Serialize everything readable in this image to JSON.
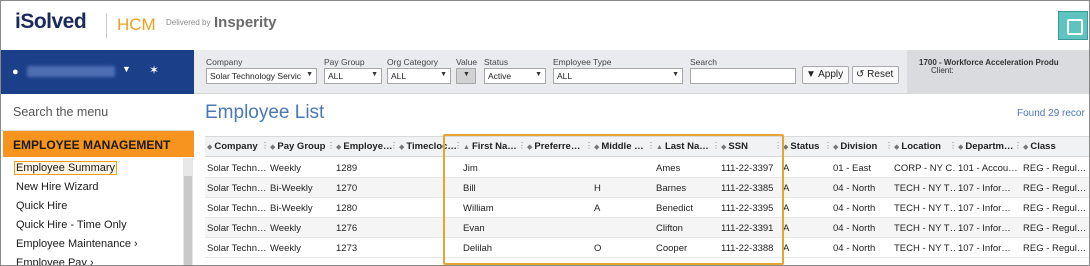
{
  "header": {
    "logo": "iSolved",
    "product": "HCM",
    "delivered_by": "Delivered by",
    "partner": "Insperity",
    "corner_icon": "app-icon"
  },
  "sidebar": {
    "user_icon": "user-icon",
    "pin_icon": "pin-icon",
    "search_placeholder": "Search the menu",
    "section": "EMPLOYEE MANAGEMENT",
    "items": [
      {
        "label": "Employee Summary",
        "selected": true
      },
      {
        "label": "New Hire Wizard"
      },
      {
        "label": "Quick Hire"
      },
      {
        "label": "Quick Hire - Time Only"
      },
      {
        "label": "Employee Maintenance ›"
      },
      {
        "label": "Employee Pay ›"
      }
    ]
  },
  "filters": {
    "company": {
      "label": "Company",
      "value": "Solar Technology Servic"
    },
    "pay_group": {
      "label": "Pay Group",
      "value": "ALL"
    },
    "org_category": {
      "label": "Org Category",
      "value": "ALL"
    },
    "value": {
      "label": "Value"
    },
    "status": {
      "label": "Status",
      "value": "Active"
    },
    "employee_type": {
      "label": "Employee Type",
      "value": "ALL"
    },
    "search": {
      "label": "Search",
      "value": ""
    },
    "apply_label": "▼ Apply",
    "reset_label": "↺ Reset",
    "client_prefix": "Client: ",
    "client_value": "1700 - Workforce Acceleration Produ"
  },
  "main": {
    "title": "Employee List",
    "found": "Found 29 recor",
    "highlight_color": "#e8a431"
  },
  "table": {
    "columns": [
      {
        "label": "Company",
        "sort": "◆"
      },
      {
        "label": "Pay Group",
        "sort": "◆"
      },
      {
        "label": "Employe…",
        "sort": "◆"
      },
      {
        "label": "Timecloc…",
        "sort": "◆"
      },
      {
        "label": "First Na…",
        "sort": "▲"
      },
      {
        "label": "Preferre…",
        "sort": "◆"
      },
      {
        "label": "Middle …",
        "sort": "◆"
      },
      {
        "label": "Last Na…",
        "sort": "▲"
      },
      {
        "label": "SSN",
        "sort": "◆"
      },
      {
        "label": "Status",
        "sort": "◆"
      },
      {
        "label": "Division",
        "sort": "◆"
      },
      {
        "label": "Location",
        "sort": "◆"
      },
      {
        "label": "Departm…",
        "sort": "◆"
      },
      {
        "label": "Class",
        "sort": "◆"
      }
    ],
    "rows": [
      [
        "Solar Techn…",
        "Weekly",
        "1289",
        "",
        "Jim",
        "",
        "",
        "Ames",
        "111-22-3397",
        "A",
        "01 - East",
        "CORP - NY C…",
        "101 - Accou…",
        "REG - Regul…"
      ],
      [
        "Solar Techn…",
        "Bi-Weekly",
        "1270",
        "",
        "Bill",
        "",
        "H",
        "Barnes",
        "111-22-3385",
        "A",
        "04 - North",
        "TECH - NY T…",
        "107 - Infor…",
        "REG - Regul…"
      ],
      [
        "Solar Techn…",
        "Bi-Weekly",
        "1280",
        "",
        "William",
        "",
        "A",
        "Benedict",
        "111-22-3395",
        "A",
        "04 - North",
        "TECH - NY T…",
        "107 - Infor…",
        "REG - Regul…"
      ],
      [
        "Solar Techn…",
        "Weekly",
        "1276",
        "",
        "Evan",
        "",
        "",
        "Clifton",
        "111-22-3391",
        "A",
        "04 - North",
        "TECH - NY T…",
        "107 - Infor…",
        "REG - Regul…"
      ],
      [
        "Solar Techn…",
        "Weekly",
        "1273",
        "",
        "Delilah",
        "",
        "O",
        "Cooper",
        "111-22-3388",
        "A",
        "04 - North",
        "TECH - NY T…",
        "107 - Infor…",
        "REG - Regul…"
      ]
    ]
  }
}
